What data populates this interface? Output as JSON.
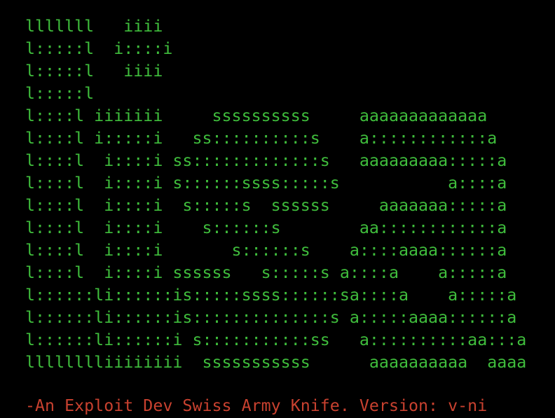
{
  "colors": {
    "background": "#000000",
    "banner": "#3fbd3c",
    "tagline": "#c8412f"
  },
  "banner": {
    "lines": [
      "lllllll   iiii",
      "l:::::l  i::::i",
      "l:::::l   iiii",
      "l:::::l",
      "l::::l iiiiiii     ssssssssss     aaaaaaaaaaaaa",
      "l::::l i:::::i   ss::::::::::s    a::::::::::::a",
      "l::::l  i::::i ss:::::::::::::s   aaaaaaaaa:::::a",
      "l::::l  i::::i s::::::ssss:::::s           a::::a",
      "l::::l  i::::i  s:::::s  ssssss     aaaaaaa:::::a",
      "l::::l  i::::i    s::::::s        aa::::::::::::a",
      "l::::l  i::::i       s::::::s    a::::aaaa::::::a",
      "l::::l  i::::i ssssss   s:::::s a::::a    a:::::a",
      "l::::::li::::::is:::::ssss::::::sa::::a    a:::::a",
      "l::::::li::::::is::::::::::::::s a:::::aaaa::::::a",
      "l::::::li::::::i s:::::::::::ss   a::::::::::aa:::a",
      "lllllllliiiiiiii  sssssssssss      aaaaaaaaaa  aaaa"
    ]
  },
  "tagline": {
    "text": "-An Exploit Dev Swiss Army Knife. Version: v-ni"
  }
}
